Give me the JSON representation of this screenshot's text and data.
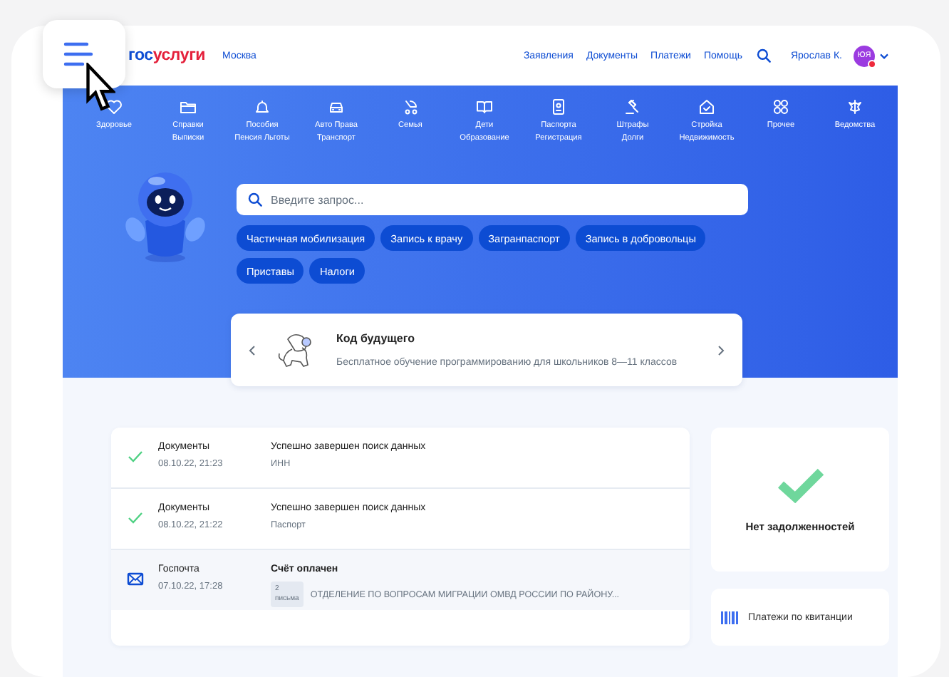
{
  "header": {
    "logo": {
      "part_1": "гос",
      "part_2": "услуги"
    },
    "city": "Москва",
    "nav": [
      "Заявления",
      "Документы",
      "Платежи",
      "Помощь"
    ],
    "user": {
      "name": "Ярослав К.",
      "initials": "ЮЯ",
      "notification": true
    }
  },
  "categories": [
    {
      "lines": [
        "Здоровье"
      ]
    },
    {
      "lines": [
        "Справки",
        "Выписки"
      ]
    },
    {
      "lines": [
        "Пособия",
        "Пенсия Льготы"
      ]
    },
    {
      "lines": [
        "Авто Права",
        "Транспорт"
      ]
    },
    {
      "lines": [
        "Семья"
      ]
    },
    {
      "lines": [
        "Дети",
        "Образование"
      ]
    },
    {
      "lines": [
        "Паспорта",
        "Регистрация"
      ]
    },
    {
      "lines": [
        "Штрафы",
        "Долги"
      ]
    },
    {
      "lines": [
        "Стройка",
        "Недвижимость"
      ]
    },
    {
      "lines": [
        "Прочее"
      ]
    },
    {
      "lines": [
        "Ведомства"
      ]
    }
  ],
  "search": {
    "placeholder": "Введите запрос..."
  },
  "chips": [
    "Частичная мобилизация",
    "Запись к врачу",
    "Загранпаспорт",
    "Запись в добровольцы",
    "Приставы",
    "Налоги"
  ],
  "promo": {
    "title": "Код будущего",
    "subtitle": "Бесплатное обучение программированию для школьников 8—11 классов"
  },
  "events": [
    {
      "kind": "success",
      "source": "Документы",
      "date": "08.10.22, 21:23",
      "title": "Успешно завершен поиск данных",
      "detail": "ИНН",
      "unread": false
    },
    {
      "kind": "success",
      "source": "Документы",
      "date": "08.10.22, 21:22",
      "title": "Успешно завершен поиск данных",
      "detail": "Паспорт",
      "unread": false
    },
    {
      "kind": "mail",
      "source": "Госпочта",
      "date": "07.10.22, 17:28",
      "title": "Счёт оплачен",
      "badge": [
        "2",
        "письма"
      ],
      "detail": "ОТДЕЛЕНИЕ ПО ВОПРОСАМ МИГРАЦИИ ОМВД РОССИИ ПО РАЙОНУ...",
      "unread": true
    }
  ],
  "debt": {
    "text": "Нет задолженностей"
  },
  "payments": {
    "label": "Платежи по квитанции"
  }
}
